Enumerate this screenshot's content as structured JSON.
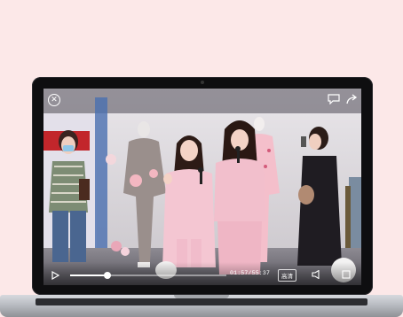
{
  "player": {
    "time_label": "01:57/55:37",
    "quality_label": "高清",
    "progress_fraction": 0.24
  },
  "icons": {
    "close": "close-icon",
    "message": "message-icon",
    "share": "share-icon",
    "play": "play-icon",
    "volume": "volume-icon",
    "fullscreen": "fullscreen-icon"
  },
  "colors": {
    "background": "#fce8e8",
    "bezel": "#0e0e10",
    "pajama_pink": "#f2c3cf"
  }
}
